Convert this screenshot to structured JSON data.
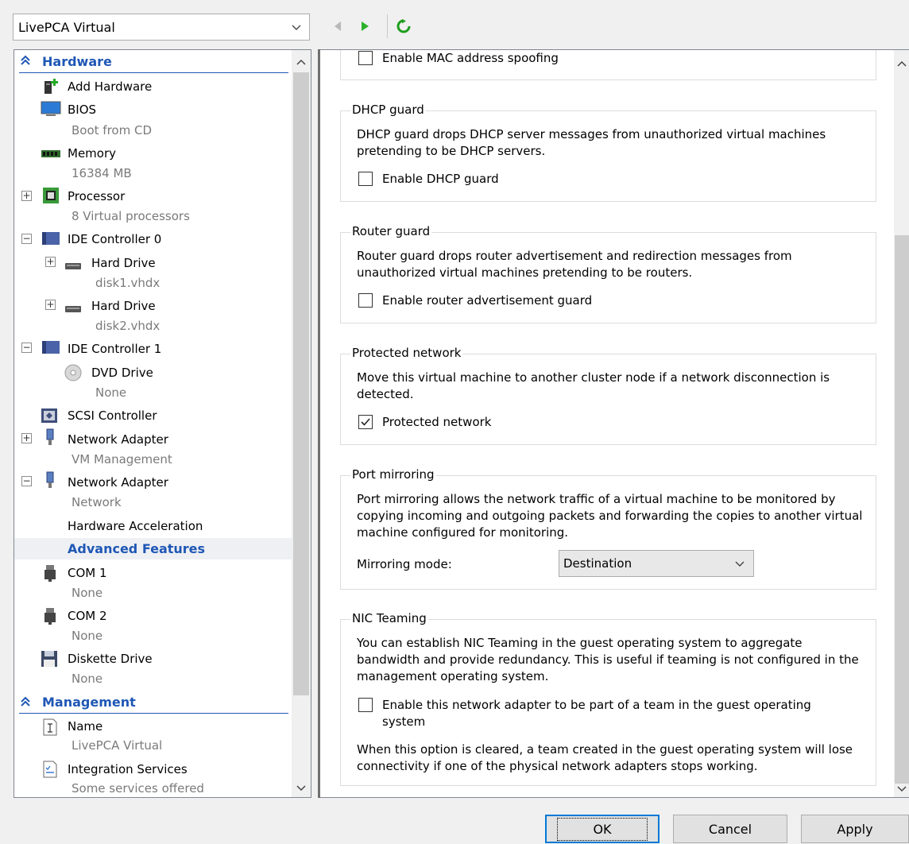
{
  "vm_selector": {
    "value": "LivePCA Virtual"
  },
  "toolbar": {
    "back_icon": "triangle-left",
    "start_icon": "triangle-right-green",
    "refresh_icon": "refresh-green"
  },
  "hardware": {
    "title": "Hardware",
    "items": [
      {
        "label": "Add Hardware",
        "icon": "add-hardware-icon"
      },
      {
        "label": "BIOS",
        "sub": "Boot from CD",
        "icon": "monitor-icon"
      },
      {
        "label": "Memory",
        "sub": "16384 MB",
        "icon": "memory-icon"
      },
      {
        "label": "Processor",
        "sub": "8 Virtual processors",
        "icon": "processor-icon"
      },
      {
        "label": "IDE Controller 0",
        "icon": "controller-icon"
      },
      {
        "label": "Hard Drive",
        "sub": "disk1.vhdx",
        "icon": "hard-drive-icon"
      },
      {
        "label": "Hard Drive",
        "sub": "disk2.vhdx",
        "icon": "hard-drive-icon"
      },
      {
        "label": "IDE Controller 1",
        "icon": "controller-icon"
      },
      {
        "label": "DVD Drive",
        "sub": "None",
        "icon": "dvd-icon"
      },
      {
        "label": "SCSI Controller",
        "icon": "scsi-icon"
      },
      {
        "label": "Network Adapter",
        "sub": "VM Management",
        "icon": "network-adapter-icon"
      },
      {
        "label": "Network Adapter",
        "sub": "Network",
        "icon": "network-adapter-icon"
      },
      {
        "label": "Hardware Acceleration"
      },
      {
        "label": "Advanced Features"
      },
      {
        "label": "COM 1",
        "sub": "None",
        "icon": "com-port-icon"
      },
      {
        "label": "COM 2",
        "sub": "None",
        "icon": "com-port-icon"
      },
      {
        "label": "Diskette Drive",
        "sub": "None",
        "icon": "diskette-icon"
      }
    ]
  },
  "management": {
    "title": "Management",
    "items": [
      {
        "label": "Name",
        "sub": "LivePCA Virtual",
        "icon": "name-icon"
      },
      {
        "label": "Integration Services",
        "sub": "Some services offered",
        "icon": "integration-icon"
      }
    ]
  },
  "mac_spoofing": {
    "label": "Enable MAC address spoofing",
    "checked": false
  },
  "dhcp_guard": {
    "title": "DHCP guard",
    "description": "DHCP guard drops DHCP server messages from unauthorized virtual machines pretending to be DHCP servers.",
    "checkbox_label": "Enable DHCP guard",
    "checked": false
  },
  "router_guard": {
    "title": "Router guard",
    "description": "Router guard drops router advertisement and redirection messages from unauthorized virtual machines pretending to be routers.",
    "checkbox_label": "Enable router advertisement guard",
    "checked": false
  },
  "protected_network": {
    "title": "Protected network",
    "description": "Move this virtual machine to another cluster node if a network disconnection is detected.",
    "checkbox_label": "Protected network",
    "checked": true
  },
  "port_mirroring": {
    "title": "Port mirroring",
    "description": "Port mirroring allows the network traffic of a virtual machine to be monitored by copying incoming and outgoing packets and forwarding the copies to another virtual machine configured for monitoring.",
    "mode_label": "Mirroring mode:",
    "mode_value": "Destination"
  },
  "nic_teaming": {
    "title": "NIC Teaming",
    "description": "You can establish NIC Teaming in the guest operating system to aggregate bandwidth and provide redundancy. This is useful if teaming is not configured in the management operating system.",
    "checkbox_label": "Enable this network adapter to be part of a team in the guest operating system",
    "checked": false,
    "note": "When this option is cleared, a team created in the guest operating system will lose connectivity if one of the physical network adapters stops working."
  },
  "buttons": {
    "ok": "OK",
    "cancel": "Cancel",
    "apply": "Apply"
  }
}
